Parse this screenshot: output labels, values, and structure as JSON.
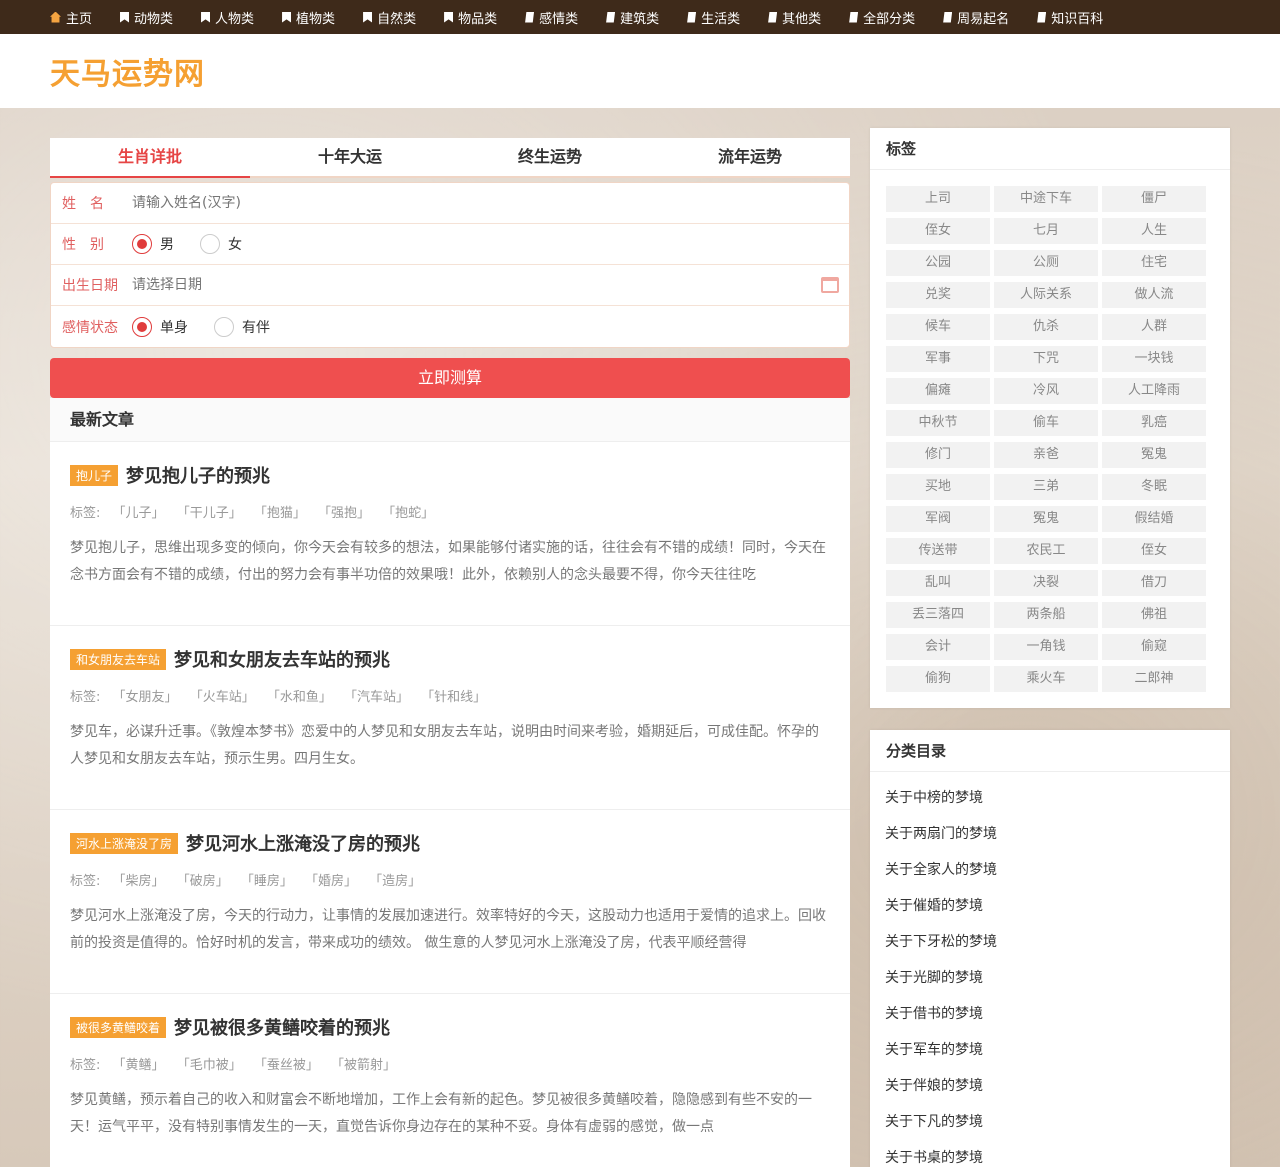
{
  "nav": [
    {
      "label": "主页",
      "icon": "home-icon"
    },
    {
      "label": "动物类",
      "icon": "bookmark-icon"
    },
    {
      "label": "人物类",
      "icon": "bookmark-icon"
    },
    {
      "label": "植物类",
      "icon": "bookmark-icon"
    },
    {
      "label": "自然类",
      "icon": "bookmark-icon"
    },
    {
      "label": "物品类",
      "icon": "bookmark-icon"
    },
    {
      "label": "感情类",
      "icon": "book-icon"
    },
    {
      "label": "建筑类",
      "icon": "book-icon"
    },
    {
      "label": "生活类",
      "icon": "book-icon"
    },
    {
      "label": "其他类",
      "icon": "book-icon"
    },
    {
      "label": "全部分类",
      "icon": "book-icon"
    },
    {
      "label": "周易起名",
      "icon": "book-icon"
    },
    {
      "label": "知识百科",
      "icon": "book-icon"
    }
  ],
  "site": {
    "title": "天马运势网"
  },
  "tabs": [
    "生肖详批",
    "十年大运",
    "终生运势",
    "流年运势"
  ],
  "form": {
    "name_label": "姓　名",
    "name_placeholder": "请输入姓名(汉字)",
    "gender_label": "性　别",
    "gender_male": "男",
    "gender_female": "女",
    "birth_label": "出生日期",
    "birth_placeholder": "请选择日期",
    "status_label": "感情状态",
    "status_single": "单身",
    "status_partner": "有伴",
    "submit": "立即测算"
  },
  "articles_title": "最新文章",
  "articles": [
    {
      "badge": "抱儿子",
      "title": "梦见抱儿子的预兆",
      "tags_label": "标签:",
      "tags": [
        "「儿子」",
        "「干儿子」",
        "「抱猫」",
        "「强抱」",
        "「抱蛇」"
      ],
      "desc": "梦见抱儿子，思维出现多变的倾向，你今天会有较多的想法，如果能够付诸实施的话，往往会有不错的成绩！同时，今天在念书方面会有不错的成绩，付出的努力会有事半功倍的效果哦！此外，依赖别人的念头最要不得，你今天往往吃"
    },
    {
      "badge": "和女朋友去车站",
      "title": "梦见和女朋友去车站的预兆",
      "tags_label": "标签:",
      "tags": [
        "「女朋友」",
        "「火车站」",
        "「水和鱼」",
        "「汽车站」",
        "「针和线」"
      ],
      "desc": "梦见车，必谋升迁事。《敦煌本梦书》恋爱中的人梦见和女朋友去车站，说明由时间来考验，婚期延后，可成佳配。怀孕的人梦见和女朋友去车站，预示生男。四月生女。"
    },
    {
      "badge": "河水上涨淹没了房",
      "title": "梦见河水上涨淹没了房的预兆",
      "tags_label": "标签:",
      "tags": [
        "「柴房」",
        "「破房」",
        "「睡房」",
        "「婚房」",
        "「造房」"
      ],
      "desc": "梦见河水上涨淹没了房，今天的行动力，让事情的发展加速进行。效率特好的今天，这股动力也适用于爱情的追求上。回收前的投资是值得的。恰好时机的发言，带来成功的绩效。 做生意的人梦见河水上涨淹没了房，代表平顺经营得"
    },
    {
      "badge": "被很多黄鳝咬着",
      "title": "梦见被很多黄鳝咬着的预兆",
      "tags_label": "标签:",
      "tags": [
        "「黄鳝」",
        "「毛巾被」",
        "「蚕丝被」",
        "「被箭射」"
      ],
      "desc": "梦见黄鳝，预示着自己的收入和财富会不断地增加，工作上会有新的起色。梦见被很多黄鳝咬着，隐隐感到有些不安的一天！运气平平，没有特别事情发生的一天，直觉告诉你身边存在的某种不妥。身体有虚弱的感觉，做一点"
    }
  ],
  "tags_panel": {
    "title": "标签",
    "tags": [
      "上司",
      "中途下车",
      "僵尸",
      "侄女",
      "七月",
      "人生",
      "公园",
      "公厕",
      "住宅",
      "兑奖",
      "人际关系",
      "做人流",
      "候车",
      "仇杀",
      "人群",
      "军事",
      "下咒",
      "一块钱",
      "偏瘫",
      "冷风",
      "人工降雨",
      "中秋节",
      "偷车",
      "乳癌",
      "修门",
      "亲爸",
      "冤鬼",
      "买地",
      "三弟",
      "冬眠",
      "军阀",
      "冤鬼",
      "假结婚",
      "传送带",
      "农民工",
      "侄女",
      "乱叫",
      "决裂",
      "借刀",
      "丢三落四",
      "两条船",
      "佛祖",
      "会计",
      "一角钱",
      "偷窥",
      "偷狗",
      "乘火车",
      "二郎神"
    ]
  },
  "category_panel": {
    "title": "分类目录",
    "items": [
      "关于中榜的梦境",
      "关于两扇门的梦境",
      "关于全家人的梦境",
      "关于催婚的梦境",
      "关于下牙松的梦境",
      "关于光脚的梦境",
      "关于借书的梦境",
      "关于军车的梦境",
      "关于伴娘的梦境",
      "关于下凡的梦境",
      "关于书桌的梦境"
    ]
  }
}
